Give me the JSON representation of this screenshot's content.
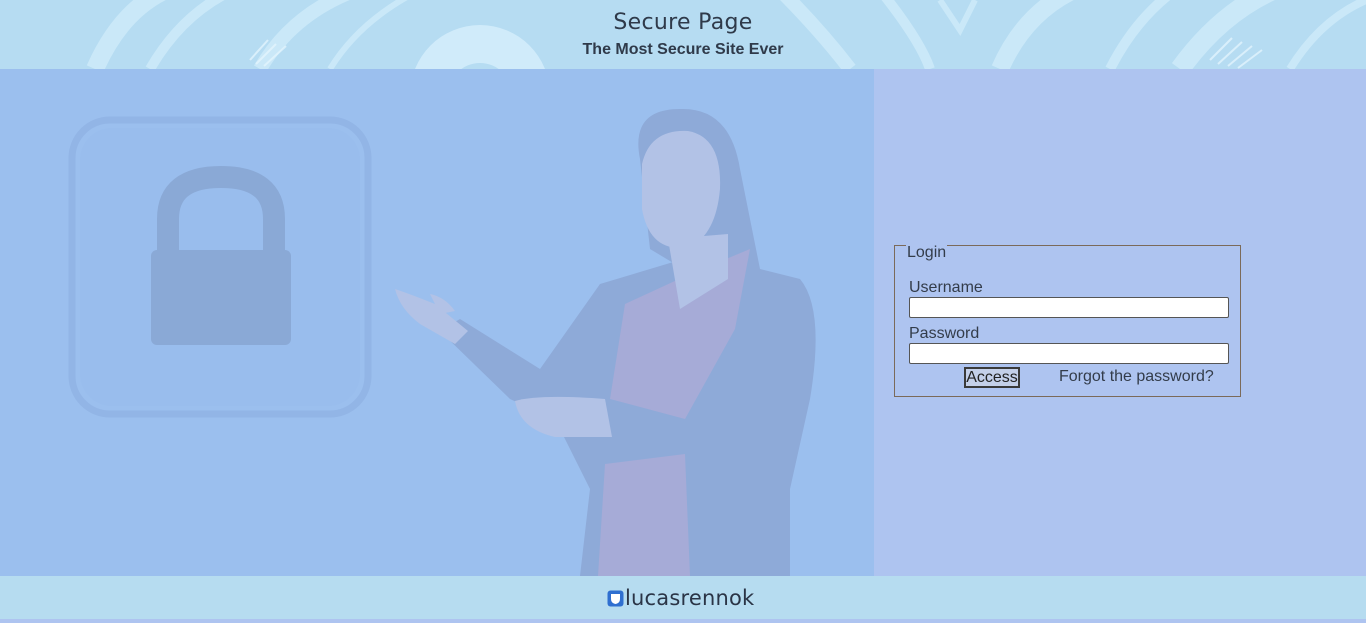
{
  "header": {
    "title": "Secure Page",
    "subtitle": "The Most Secure Site Ever"
  },
  "login": {
    "legend": "Login",
    "username_label": "Username",
    "username_value": "",
    "password_label": "Password",
    "password_value": "",
    "submit_label": "Access",
    "forgot_label": "Forgot the password?"
  },
  "footer": {
    "brand": "lucasrennok",
    "logo_icon": "shield-logo-icon"
  },
  "colors": {
    "header_bg": "#b6dcf2",
    "hero_bg": "#9bbfee",
    "side_bg": "#aec4f0",
    "footer_bg": "#b6dcf0",
    "logo_blue": "#2f6fd0",
    "text": "#333c4a"
  },
  "hero": {
    "illustration_icons": [
      "padlock-icon",
      "presenter-woman-illustration"
    ]
  }
}
